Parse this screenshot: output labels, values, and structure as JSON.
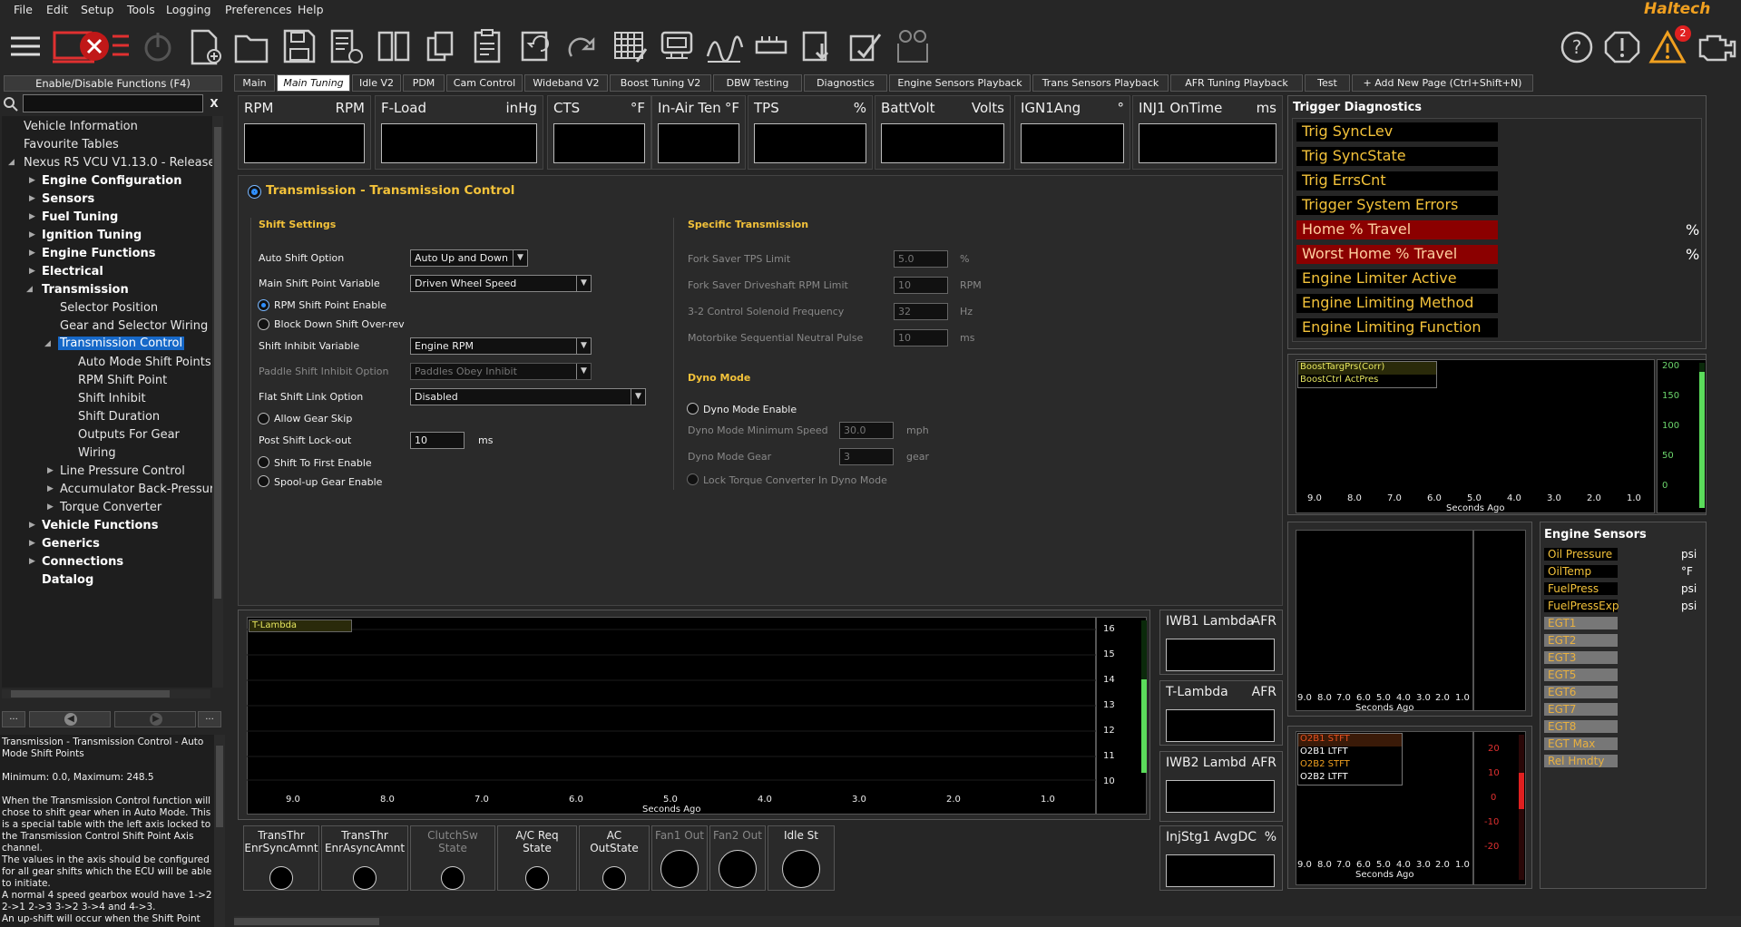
{
  "menu": [
    "File",
    "Edit",
    "Setup",
    "Tools",
    "Logging",
    "Preferences",
    "Help"
  ],
  "brand": "Haltech",
  "alert_count": "2",
  "sidebar": {
    "enable_label": "Enable/Disable Functions (F4)",
    "clear": "X",
    "tree": [
      "Vehicle Information",
      "Favourite Tables",
      "Nexus R5 VCU V1.13.0 - Release",
      "Engine Configuration",
      "Sensors",
      "Fuel Tuning",
      "Ignition Tuning",
      "Engine Functions",
      "Electrical",
      "Transmission",
      "Selector Position",
      "Gear and Selector Wiring",
      "Transmission Control",
      "Auto Mode Shift Points",
      "RPM Shift Point",
      "Shift Inhibit",
      "Shift Duration",
      "Outputs For Gear",
      "Wiring",
      "Line Pressure Control",
      "Accumulator Back-Pressure",
      "Torque Converter",
      "Vehicle Functions",
      "Generics",
      "Connections",
      "Datalog"
    ],
    "nav_more": "...",
    "help": "Transmission - Transmission Control - Auto Mode Shift Points\n\nMinimum: 0.0, Maximum: 248.5\n\nWhen the Transmission Control function will chose to shift gear when in Auto Mode. This is a special table with the left axis locked to the Transmission Control Shift Point Axis channel.\nThe values in the axis should be configured for all gear shifts which the ECU will be able to initiate.\nA normal 4 speed gearbox would have 1->2 2->1 2->3 3->2 3->4 and 4->3.\nAn up-shift will occur when the Shift Point"
  },
  "tabs": [
    "Main",
    "Main Tuning",
    "Idle V2",
    "PDM",
    "Cam Control",
    "Wideband V2",
    "Boost Tuning V2",
    "DBW Testing",
    "Diagnostics",
    "Engine Sensors Playback",
    "Trans Sensors Playback",
    "AFR Tuning Playback",
    "Test",
    "+ Add New Page (Ctrl+Shift+N)"
  ],
  "gauges": [
    {
      "label": "RPM",
      "unit": "RPM"
    },
    {
      "label": "F-Load",
      "unit": "inHg"
    },
    {
      "label": "CTS",
      "unit": "°F"
    },
    {
      "label": "In-Air Ten",
      "unit": "°F"
    },
    {
      "label": "TPS",
      "unit": "%"
    },
    {
      "label": "BattVolt",
      "unit": "Volts"
    },
    {
      "label": "IGN1Ang",
      "unit": "°"
    },
    {
      "label": "INJ1 OnTime",
      "unit": "ms"
    }
  ],
  "panel": {
    "title": "Transmission - Transmission Control",
    "shift_settings": "Shift Settings",
    "auto_shift_label": "Auto Shift Option",
    "auto_shift_value": "Auto Up and Down",
    "main_shift_label": "Main Shift Point Variable",
    "main_shift_value": "Driven Wheel Speed",
    "rpm_shift_enable": "RPM Shift Point Enable",
    "block_down": "Block Down Shift Over-rev",
    "inhibit_label": "Shift Inhibit Variable",
    "inhibit_value": "Engine RPM",
    "paddle_label": "Paddle Shift Inhibit Option",
    "paddle_value": "Paddles Obey Inhibit",
    "flat_label": "Flat Shift Link Option",
    "flat_value": "Disabled",
    "allow_skip": "Allow Gear Skip",
    "lockout_label": "Post Shift Lock-out",
    "lockout_value": "10",
    "lockout_unit": "ms",
    "first_enable": "Shift To First Enable",
    "spool_enable": "Spool-up Gear Enable",
    "specific": "Specific Transmission",
    "fork_tps": "Fork Saver TPS Limit",
    "fork_tps_v": "5.0",
    "fork_tps_u": "%",
    "fork_rpm": "Fork Saver Driveshaft RPM Limit",
    "fork_rpm_v": "10",
    "fork_rpm_u": "RPM",
    "sol_freq": "3-2 Control Solenoid Frequency",
    "sol_freq_v": "32",
    "sol_freq_u": "Hz",
    "moto": "Motorbike Sequential Neutral Pulse",
    "moto_v": "10",
    "moto_u": "ms",
    "dyno": "Dyno Mode",
    "dyno_enable": "Dyno Mode Enable",
    "dyno_speed": "Dyno Mode Minimum Speed",
    "dyno_speed_v": "30.0",
    "dyno_speed_u": "mph",
    "dyno_gear": "Dyno Mode Gear",
    "dyno_gear_v": "3",
    "dyno_gear_u": "gear",
    "lock_tc": "Lock Torque Converter In Dyno Mode"
  },
  "trigger": {
    "title": "Trigger Diagnostics",
    "rows": [
      "Trig SyncLev",
      "Trig SyncState",
      "Trig ErrsCnt",
      "Trigger System Errors",
      "Home % Travel",
      "Worst Home % Travel",
      "Engine Limiter Active",
      "Engine Limiting Method",
      "Engine Limiting Function"
    ],
    "pct": "%"
  },
  "boost_chart": {
    "legend": [
      "BoostTargPrs(Corr)",
      "BoostCtrl ActPres"
    ],
    "y": [
      "200",
      "150",
      "100",
      "50",
      "0"
    ],
    "x": [
      "9.0",
      "8.0",
      "7.0",
      "6.0",
      "5.0",
      "4.0",
      "3.0",
      "2.0",
      "1.0"
    ],
    "xlabel": "Seconds Ago"
  },
  "lambda_chart": {
    "legend": "T-Lambda",
    "y": [
      "16",
      "15",
      "14",
      "13",
      "12",
      "11",
      "10"
    ],
    "x": [
      "9.0",
      "8.0",
      "7.0",
      "6.0",
      "5.0",
      "4.0",
      "3.0",
      "2.0",
      "1.0"
    ],
    "xlabel": "Seconds Ago"
  },
  "mid_chart": {
    "x": [
      "9.0",
      "8.0",
      "7.0",
      "6.0",
      "5.0",
      "4.0",
      "3.0",
      "2.0",
      "1.0"
    ],
    "xlabel": "Seconds Ago"
  },
  "trim_chart": {
    "legend": [
      "O2B1 STFT",
      "O2B1 LTFT",
      "O2B2 STFT",
      "O2B2 LTFT"
    ],
    "y": [
      "20",
      "10",
      "0",
      "-10",
      "-20"
    ],
    "x": [
      "9.0",
      "8.0",
      "7.0",
      "6.0",
      "5.0",
      "4.0",
      "3.0",
      "2.0",
      "1.0"
    ],
    "xlabel": "Seconds Ago"
  },
  "engine_sensors": {
    "title": "Engine Sensors",
    "rows": [
      {
        "n": "Oil Pressure",
        "u": "psi"
      },
      {
        "n": "OilTemp",
        "u": "°F"
      },
      {
        "n": "FuelPress",
        "u": "psi"
      },
      {
        "n": "FuelPressExp",
        "u": "psi"
      }
    ],
    "grey": [
      "EGT1",
      "EGT2",
      "EGT3",
      "EGT5",
      "EGT6",
      "EGT7",
      "EGT8",
      "EGT Max",
      "Rel Hmdty"
    ]
  },
  "side_gauges": [
    {
      "l": "IWB1 Lambda",
      "u": "AFR"
    },
    {
      "l": "T-Lambda",
      "u": "AFR"
    },
    {
      "l": "IWB2 Lambd",
      "u": "AFR"
    },
    {
      "l": "InjStg1 AvgDC",
      "u": "%"
    }
  ],
  "states": [
    {
      "a": "TransThr",
      "b": "EnrSyncAmnt"
    },
    {
      "a": "TransThr",
      "b": "EnrAsyncAmnt"
    },
    {
      "a": "ClutchSw",
      "b": "State"
    },
    {
      "a": "A/C Req",
      "b": "State"
    },
    {
      "a": "AC",
      "b": "OutState"
    },
    {
      "a": "Fan1 Out",
      "b": ""
    },
    {
      "a": "Fan2 Out",
      "b": ""
    },
    {
      "a": "Idle St",
      "b": ""
    }
  ]
}
